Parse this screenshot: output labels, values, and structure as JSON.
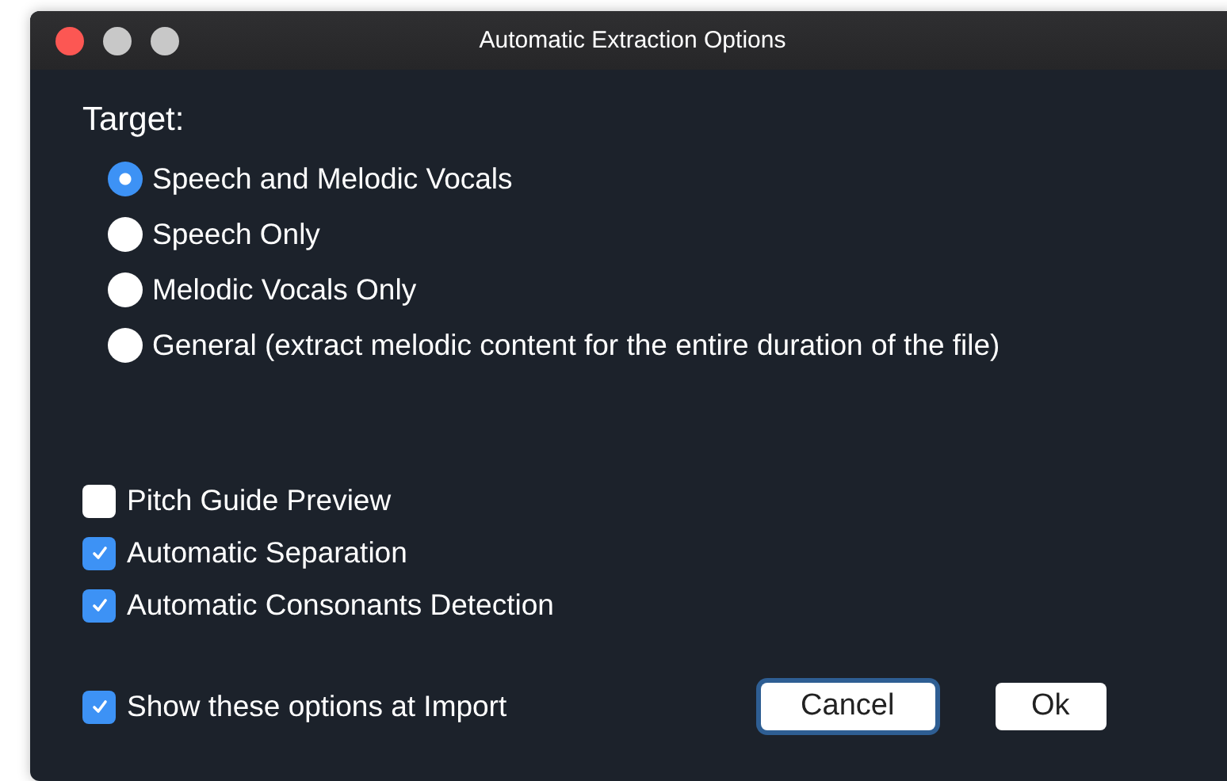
{
  "window": {
    "title": "Automatic Extraction Options"
  },
  "target": {
    "label": "Target:",
    "options": [
      {
        "label": "Speech and Melodic Vocals",
        "selected": true
      },
      {
        "label": "Speech Only",
        "selected": false
      },
      {
        "label": "Melodic Vocals Only",
        "selected": false
      },
      {
        "label": "General (extract melodic content for the entire duration of the file)",
        "selected": false
      }
    ]
  },
  "options": [
    {
      "label": "Pitch Guide Preview",
      "checked": false
    },
    {
      "label": "Automatic Separation",
      "checked": true
    },
    {
      "label": "Automatic Consonants Detection",
      "checked": true
    }
  ],
  "show_at_import": {
    "label": "Show these options at Import",
    "checked": true
  },
  "buttons": [
    {
      "label": "Cancel",
      "focused": true
    },
    {
      "label": "Ok",
      "focused": false
    }
  ]
}
